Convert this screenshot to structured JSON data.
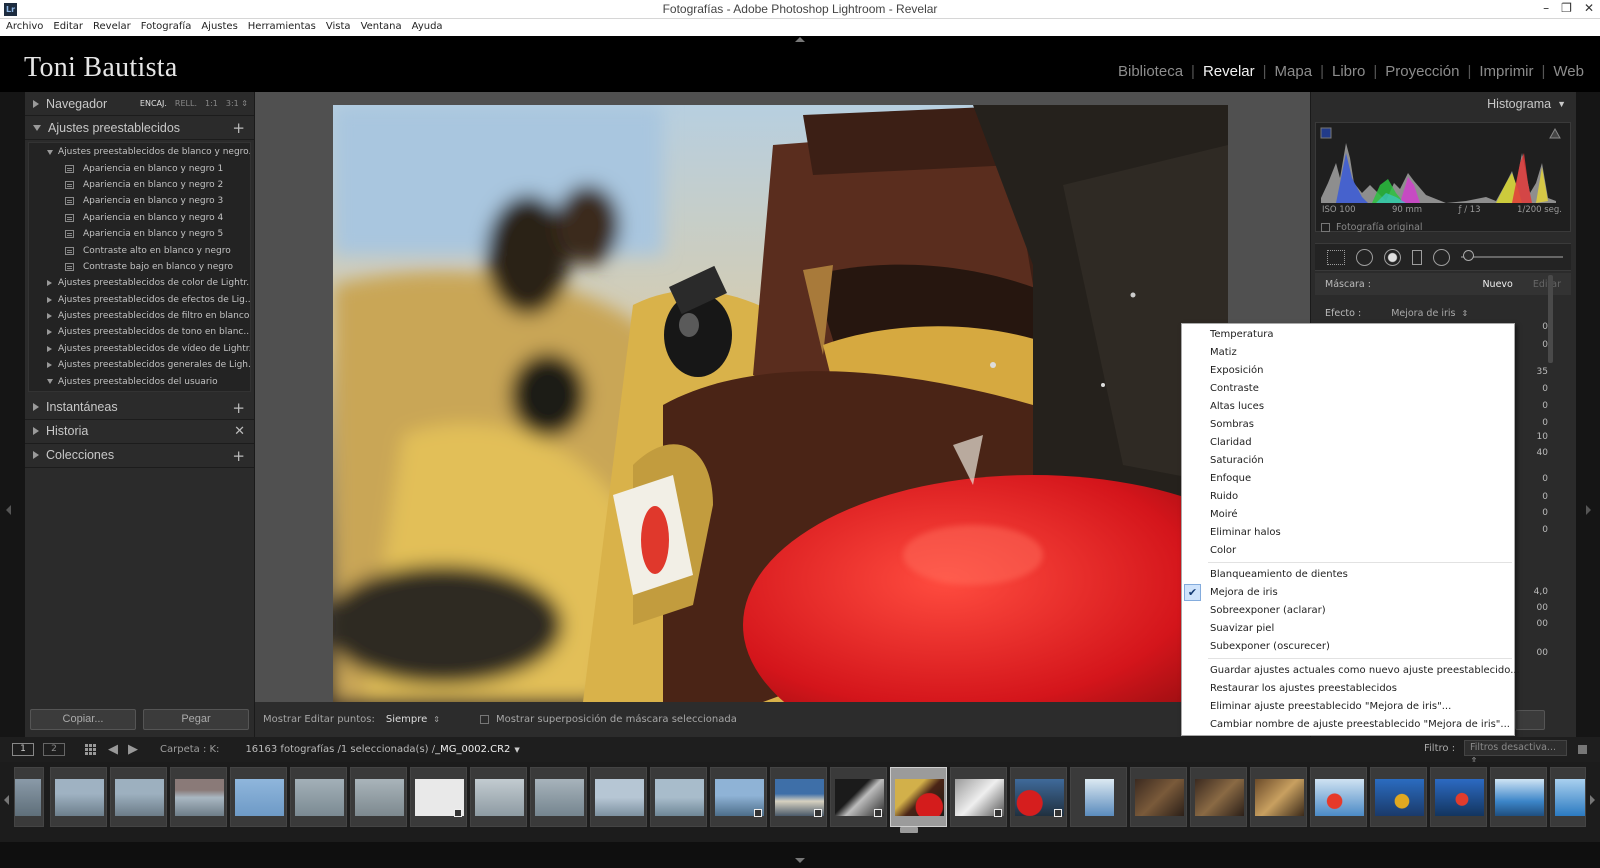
{
  "window": {
    "icon": "Lr",
    "title": "Fotografías - Adobe Photoshop Lightroom - Revelar",
    "controls": [
      "–",
      "❐",
      "✕"
    ]
  },
  "menubar": [
    "Archivo",
    "Editar",
    "Revelar",
    "Fotografía",
    "Ajustes",
    "Herramientas",
    "Vista",
    "Ventana",
    "Ayuda"
  ],
  "identity_plate": "Toni Bautista",
  "modules": [
    {
      "label": "Biblioteca",
      "active": false
    },
    {
      "label": "Revelar",
      "active": true
    },
    {
      "label": "Mapa",
      "active": false
    },
    {
      "label": "Libro",
      "active": false
    },
    {
      "label": "Proyección",
      "active": false
    },
    {
      "label": "Imprimir",
      "active": false
    },
    {
      "label": "Web",
      "active": false
    }
  ],
  "navigator": {
    "title": "Navegador",
    "options": [
      "ENCAJ.",
      "RELL.",
      "1:1",
      "3:1 ⇕"
    ]
  },
  "presets": {
    "title": "Ajustes preestablecidos",
    "open_folder": "Ajustes preestablecidos de blanco y negro...",
    "items": [
      "Apariencia en blanco y negro 1",
      "Apariencia en blanco y negro 2",
      "Apariencia en blanco y negro 3",
      "Apariencia en blanco y negro 4",
      "Apariencia en blanco y negro 5",
      "Contraste alto en blanco y negro",
      "Contraste bajo en blanco y negro"
    ],
    "folders": [
      "Ajustes preestablecidos de color de Lightr...",
      "Ajustes preestablecidos de efectos de Lig...",
      "Ajustes preestablecidos de filtro en blanco...",
      "Ajustes preestablecidos de tono en blanc...",
      "Ajustes preestablecidos de vídeo de Lightr...",
      "Ajustes preestablecidos generales de Ligh..."
    ],
    "user_folder": "Ajustes preestablecidos del usuario"
  },
  "snapshots_title": "Instantáneas",
  "history_title": "Historia",
  "collections_title": "Colecciones",
  "copy_button": "Copiar...",
  "paste_button": "Pegar",
  "toolbar": {
    "show_edit_points_label": "Mostrar Editar puntos:",
    "show_edit_points_value": "Siempre",
    "show_mask_overlay": "Mostrar superposición de máscara seleccionada"
  },
  "histogram": {
    "title": "Histograma",
    "iso": "ISO 100",
    "focal": "90 mm",
    "aperture": "ƒ / 13",
    "shutter": "1/200 seg.",
    "original_photo": "Fotografía original"
  },
  "mask": {
    "label": "Máscara :",
    "new": "Nuevo",
    "edit": "Editar"
  },
  "effect": {
    "label": "Efecto :",
    "value": "Mejora de iris"
  },
  "hidden_values": [
    "0",
    "0",
    "35",
    "0",
    "0",
    "0",
    "0",
    "10",
    "40",
    "0",
    "0",
    "0",
    "0",
    "4,0",
    "00",
    "00",
    "00"
  ],
  "effect_menu": {
    "group1": [
      "Temperatura",
      "Matiz",
      "Exposición",
      "Contraste",
      "Altas luces",
      "Sombras",
      "Claridad",
      "Saturación",
      "Enfoque",
      "Ruido",
      "Moiré",
      "Eliminar halos",
      "Color"
    ],
    "group2": [
      "Blanqueamiento de dientes",
      "Mejora de iris",
      "Sobreexponer (aclarar)",
      "Suavizar piel",
      "Subexponer (oscurecer)"
    ],
    "checked": "Mejora de iris",
    "group3": [
      "Guardar ajustes actuales como nuevo ajuste preestablecido...",
      "Restaurar los ajustes preestablecidos",
      "Eliminar ajuste preestablecido \"Mejora de iris\"...",
      "Cambiar nombre de ajuste preestablecido \"Mejora de iris\"..."
    ]
  },
  "filmstrip_bar": {
    "screen1": "1",
    "screen2": "2",
    "source": "Carpeta : K:",
    "count": "16163 fotografías /1 seleccionada(s) /",
    "filename": "_MG_0002.CR2",
    "filter_label": "Filtro :",
    "filter_value": "Filtros desactiva... ⇕"
  },
  "colors": {
    "accent_text": "#f2f2f2",
    "panel_bg": "#2b2b2b",
    "background": "#505050"
  }
}
